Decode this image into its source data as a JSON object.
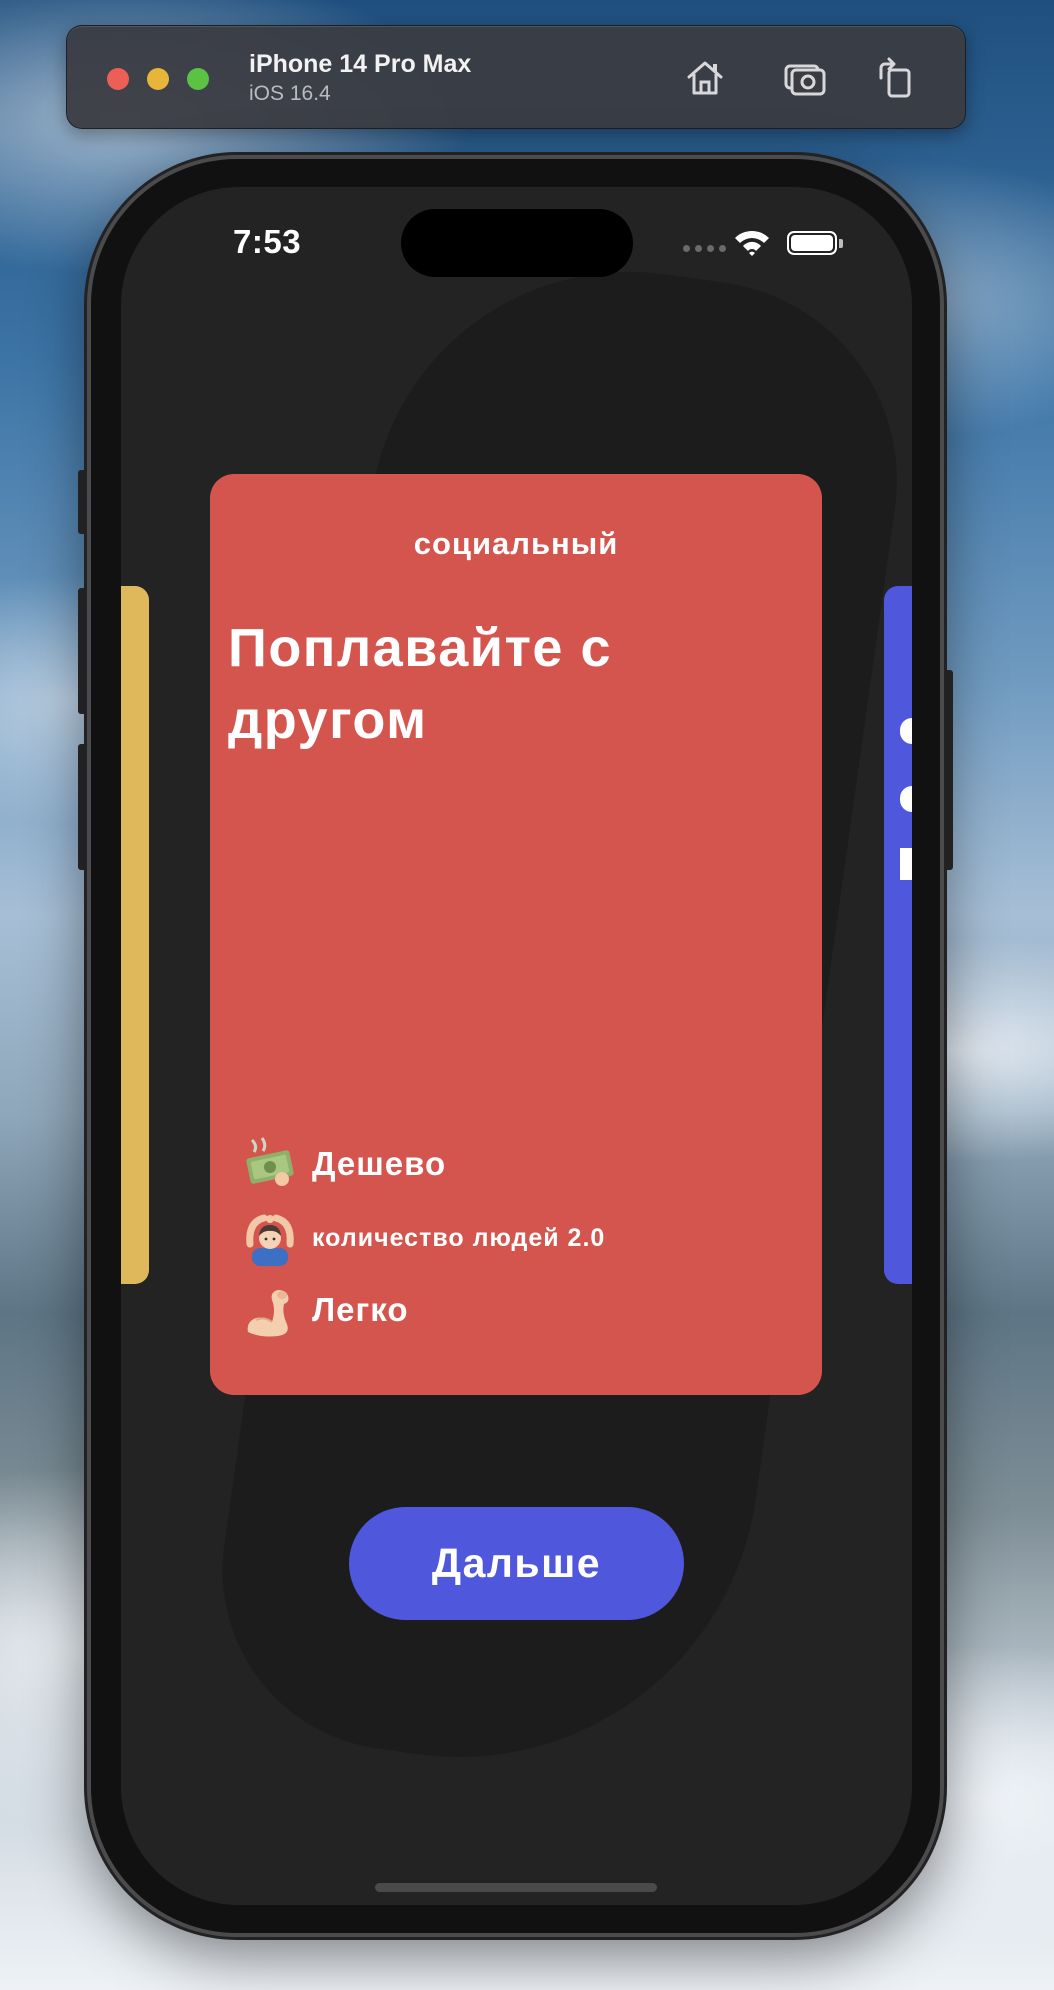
{
  "simulator": {
    "device_name": "iPhone 14 Pro Max",
    "os_version": "iOS 16.4",
    "icons": [
      "home-icon",
      "screenshot-icon",
      "rotate-icon"
    ]
  },
  "status_bar": {
    "time": "7:53"
  },
  "card": {
    "category": "социальный",
    "title": "Поплавайте с другом",
    "background_color": "#d4554d",
    "attributes": [
      {
        "emoji": "money-with-wings",
        "label": "Дешево"
      },
      {
        "emoji": "person-gesturing-ok",
        "label": "количество людей 2.0"
      },
      {
        "emoji": "flexed-biceps",
        "label": "Легко"
      }
    ]
  },
  "side_cards": {
    "left_color": "#dfb85c",
    "right_color": "#4f57dd"
  },
  "next_button": {
    "label": "Дальше",
    "color": "#4f57dd"
  }
}
